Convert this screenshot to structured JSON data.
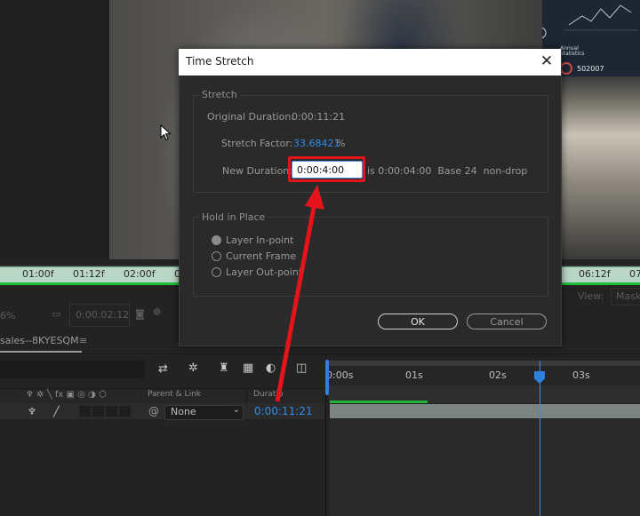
{
  "colors": {
    "accent_blue": "#2d8ceb",
    "annotation_red": "#e4141b",
    "ruler_green": "#1fbf3a"
  },
  "viewer": {
    "stats_label_1": "Annual",
    "stats_label_2": "Statistics",
    "stats_value": "502007",
    "ruler_ticks": [
      "01:00f",
      "01:12f",
      "02:00f",
      "0",
      "06:12f",
      "07"
    ],
    "view_label": "View:",
    "mask_label": "Mask",
    "zoom_fragment": "6%",
    "current_time": "0:00:02:12"
  },
  "timeline": {
    "tab_label": "sales--8KYESQM",
    "tab_menu_icon": "≡",
    "columns": {
      "parent_link": "Parent & Link",
      "duration": "Duratio"
    },
    "layer": {
      "parent_value": "None",
      "duration_value": "0:00:11:21"
    },
    "ruler_ticks": [
      "0:00s",
      "01s",
      "02s",
      "03s"
    ]
  },
  "dialog": {
    "title": "Time Stretch",
    "close_glyph": "✕",
    "stretch_group": {
      "title": "Stretch",
      "original_duration_label": "Original Duration:",
      "original_duration_value": "0:00:11:21",
      "stretch_factor_label": "Stretch Factor:",
      "stretch_factor_value": "33.68421",
      "stretch_factor_unit": "%",
      "new_duration_label": "New Duration:",
      "new_duration_value": "0:00:4:00",
      "new_duration_info": "is 0:00:04:00  Base 24  non-drop"
    },
    "hold_group": {
      "title": "Hold in Place",
      "options": [
        {
          "label": "Layer In-point",
          "checked": true
        },
        {
          "label": "Current Frame",
          "checked": false
        },
        {
          "label": "Layer Out-point",
          "checked": false
        }
      ]
    },
    "buttons": {
      "ok": "OK",
      "cancel": "Cancel"
    }
  }
}
